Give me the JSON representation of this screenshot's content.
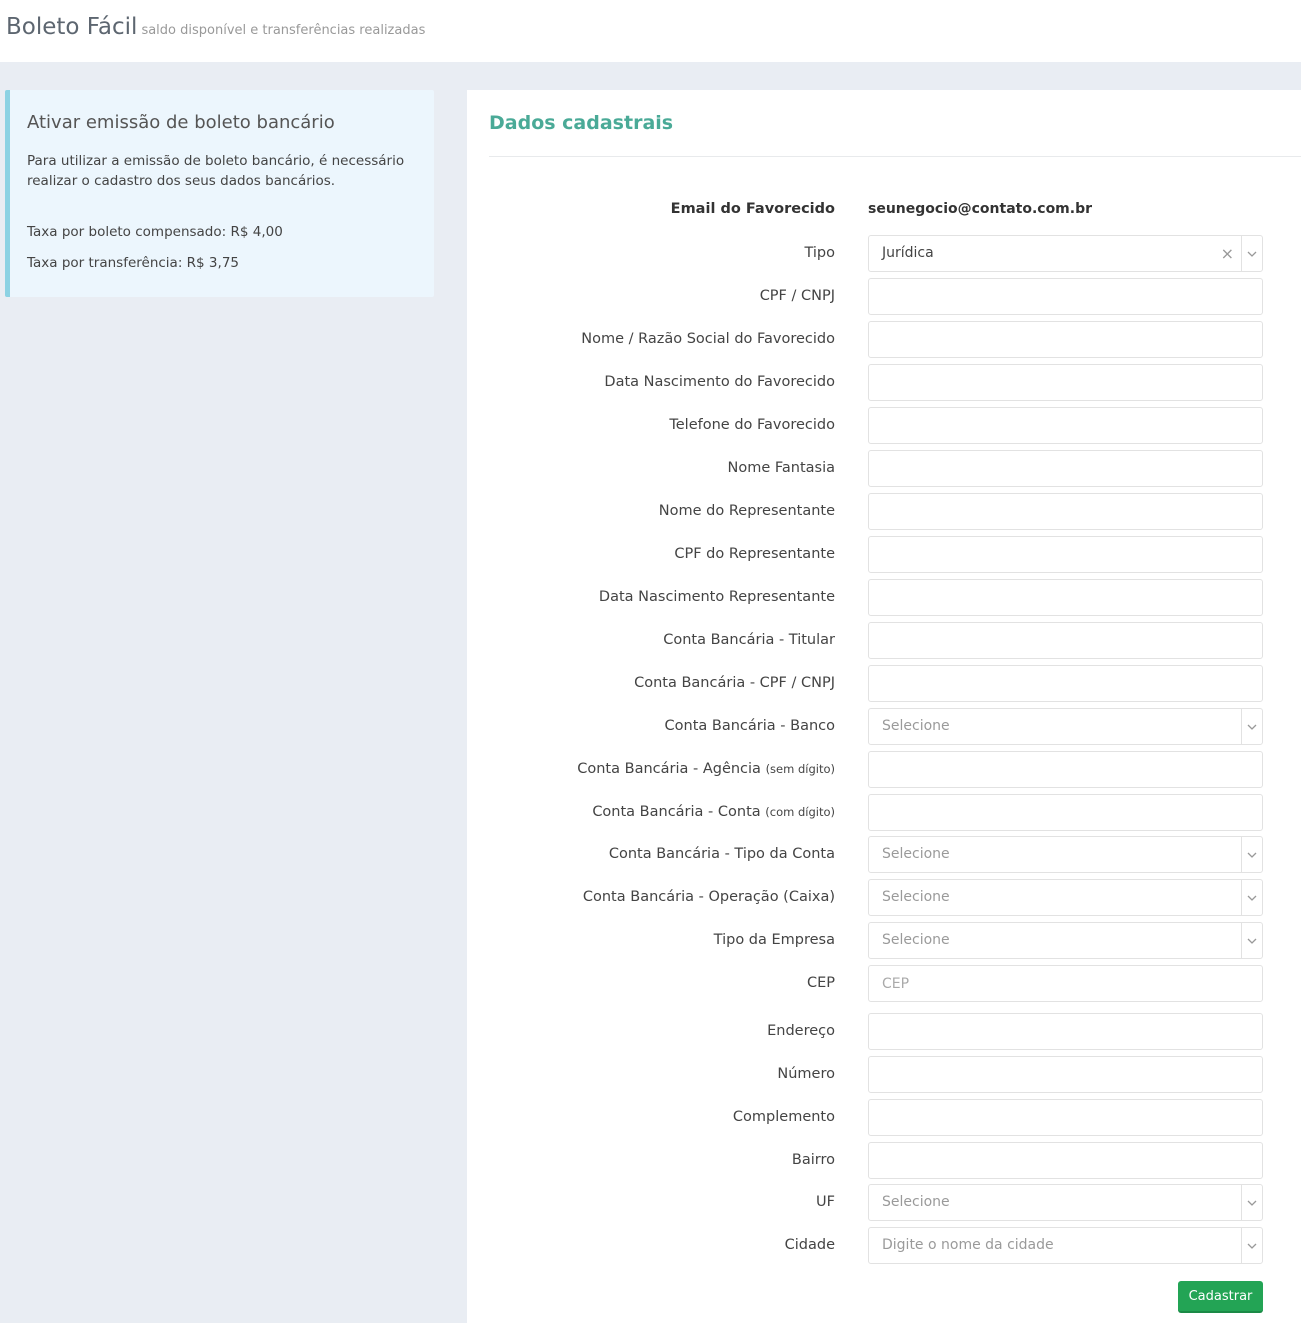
{
  "header": {
    "title": "Boleto Fácil",
    "subtitle": "saldo disponível e transferências realizadas"
  },
  "info": {
    "title": "Ativar emissão de boleto bancário",
    "text": "Para utilizar a emissão de boleto bancário, é necessário realizar o cadastro dos seus dados bancários.",
    "fee_boleto": "Taxa por boleto compensado: R$ 4,00",
    "fee_transfer": "Taxa por transferência: R$ 3,75"
  },
  "form": {
    "title": "Dados cadastrais",
    "email_label": "Email do Favorecido",
    "email_value": "seunegocio@contato.com.br",
    "tipo_label": "Tipo",
    "tipo_value": "Jurídica",
    "cpf_cnpj_label": "CPF / CNPJ",
    "nome_razao_label": "Nome / Razão Social do Favorecido",
    "data_nasc_label": "Data Nascimento do Favorecido",
    "telefone_label": "Telefone do Favorecido",
    "nome_fantasia_label": "Nome Fantasia",
    "nome_rep_label": "Nome do Representante",
    "cpf_rep_label": "CPF do Representante",
    "data_nasc_rep_label": "Data Nascimento Representante",
    "titular_label": "Conta Bancária - Titular",
    "conta_cpf_label": "Conta Bancária - CPF / CNPJ",
    "banco_label": "Conta Bancária - Banco",
    "agencia_label": "Conta Bancária - Agência",
    "agencia_hint": "(sem dígito)",
    "conta_label": "Conta Bancária - Conta",
    "conta_hint": "(com dígito)",
    "tipo_conta_label": "Conta Bancária - Tipo da Conta",
    "operacao_label": "Conta Bancária - Operação (Caixa)",
    "tipo_empresa_label": "Tipo da Empresa",
    "cep_label": "CEP",
    "cep_placeholder": "CEP",
    "endereco_label": "Endereço",
    "numero_label": "Número",
    "complemento_label": "Complemento",
    "bairro_label": "Bairro",
    "uf_label": "UF",
    "cidade_label": "Cidade",
    "cidade_placeholder": "Digite o nome da cidade",
    "select_placeholder": "Selecione",
    "submit_label": "Cadastrar"
  },
  "colors": {
    "accent": "#4aaa97",
    "button": "#23a455",
    "info_border": "#8cd2e3"
  }
}
